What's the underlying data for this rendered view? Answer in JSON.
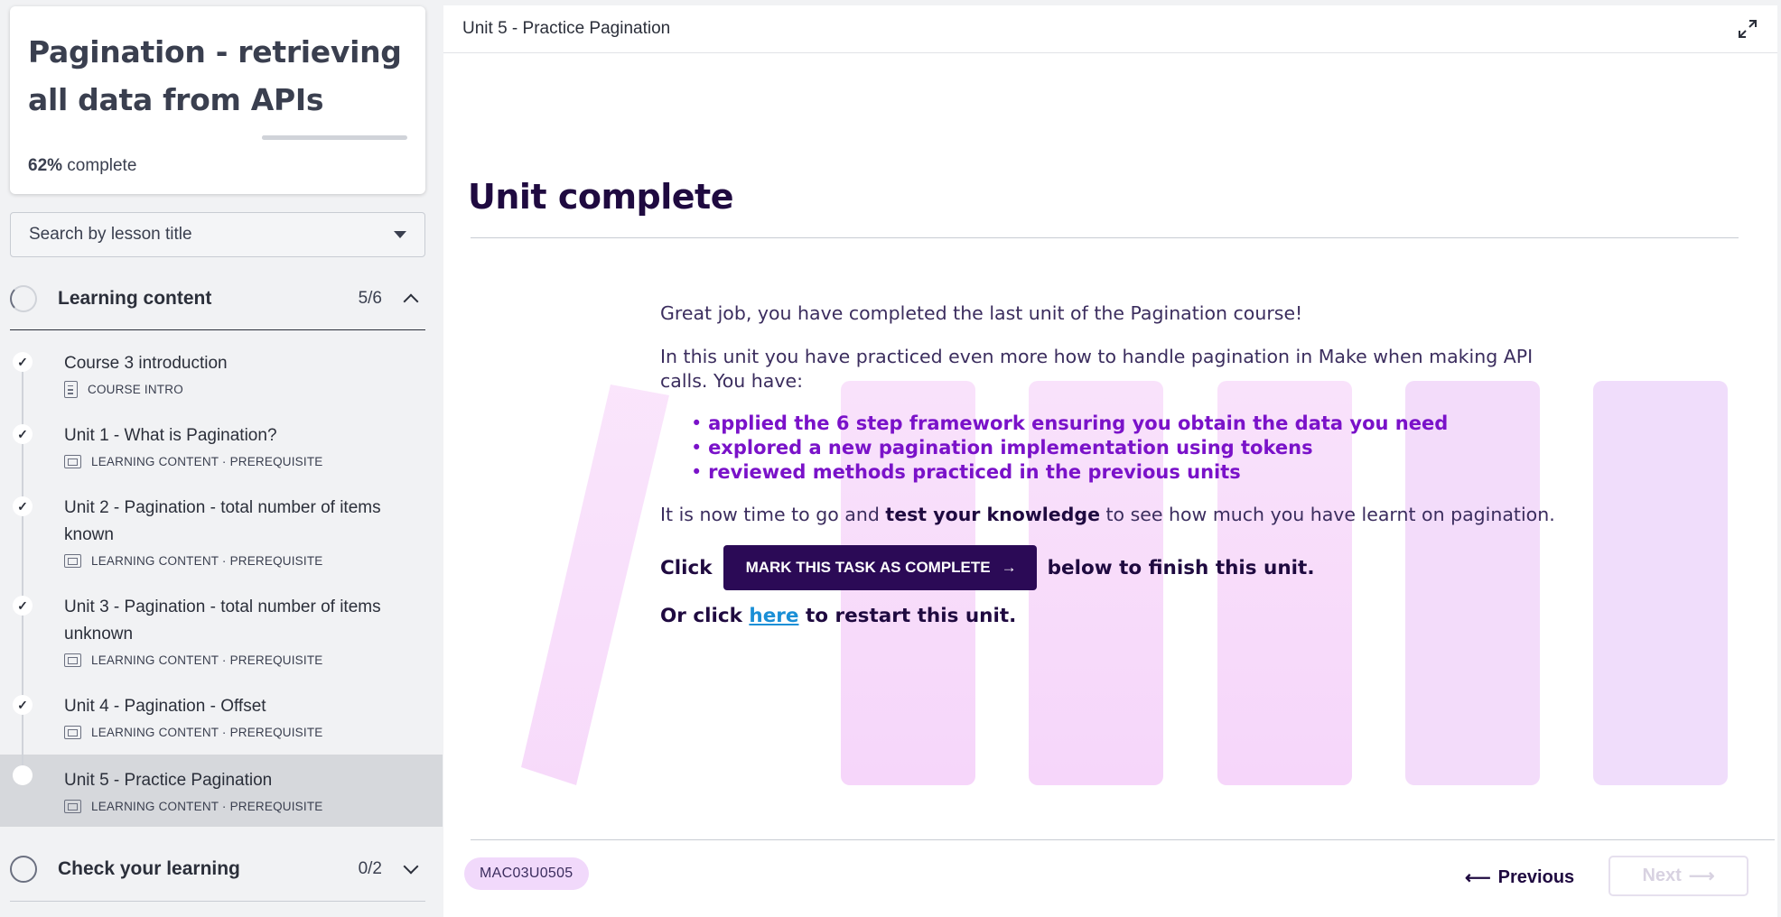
{
  "sidebar": {
    "course_title": "Pagination - retrieving all data from APIs",
    "progress": {
      "percent": "62%",
      "suffix": " complete",
      "fraction": 0.62
    },
    "search": {
      "label": "Search by lesson title"
    },
    "sections": [
      {
        "title": "Learning content",
        "count": "5/6",
        "expanded": true
      },
      {
        "title": "Check your learning",
        "count": "0/2",
        "expanded": false
      }
    ],
    "lessons": [
      {
        "title": "Course 3 introduction",
        "meta": "COURSE INTRO",
        "icon": "document-icon",
        "done": true
      },
      {
        "title": "Unit 1 - What is Pagination?",
        "meta": "LEARNING CONTENT · PREREQUISITE",
        "icon": "slides-icon",
        "done": true
      },
      {
        "title": "Unit 2 - Pagination - total number of items known",
        "meta": "LEARNING CONTENT · PREREQUISITE",
        "icon": "slides-icon",
        "done": true
      },
      {
        "title": "Unit 3 - Pagination - total number of items unknown",
        "meta": "LEARNING CONTENT · PREREQUISITE",
        "icon": "slides-icon",
        "done": true
      },
      {
        "title": "Unit 4 - Pagination - Offset",
        "meta": "LEARNING CONTENT · PREREQUISITE",
        "icon": "slides-icon",
        "done": true
      },
      {
        "title": "Unit 5 - Practice Pagination",
        "meta": "LEARNING CONTENT · PREREQUISITE",
        "icon": "slides-icon",
        "done": false,
        "active": true
      }
    ]
  },
  "main": {
    "header_title": "Unit 5 - Practice Pagination",
    "unit_title": "Unit complete",
    "para1": "Great job, you have completed the last unit of the Pagination course!",
    "para2": "In this unit you have practiced even more how to handle pagination in Make when making API calls. You have:",
    "bullets": [
      "applied the 6 step framework ensuring you obtain the data you need",
      "explored a new pagination implementation using tokens",
      "reviewed methods practiced in the previous units"
    ],
    "para3_before": "It is now time to go and ",
    "para3_bold": "test your knowledge",
    "para3_after": " to see how much you have learnt on pagination.",
    "click_prefix": "Click",
    "mark_button": "MARK THIS TASK AS COMPLETE",
    "click_suffix": "below to finish this unit.",
    "restart_prefix": "Or click ",
    "restart_link": "here",
    "restart_suffix": " to restart this unit.",
    "unit_code": "MAC03U0505",
    "prev_label": "Previous",
    "next_label": "Next",
    "colors": {
      "accent": "#2b0a56",
      "bullet": "#7a12c9",
      "link": "#1a8fd6",
      "badge": "#f1d9fb"
    }
  }
}
